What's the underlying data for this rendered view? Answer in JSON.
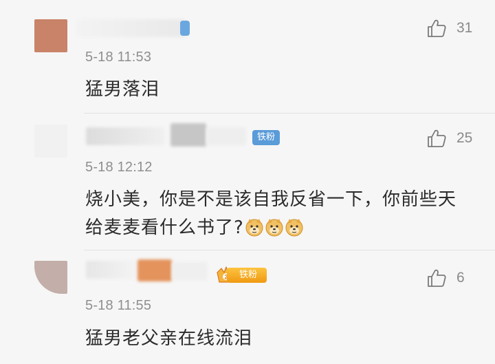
{
  "comments": [
    {
      "timestamp": "5-18 11:53",
      "text": "猛男落泪",
      "likes": "31",
      "avatar_color": "#c98368"
    },
    {
      "timestamp": "5-18 12:12",
      "text_line1": "烧小美，你是不是该自我反省一下，你前些天",
      "text_line2": "给麦麦看什么书了?",
      "badge": "铁粉",
      "likes": "25",
      "emojis": [
        "doge-emoji",
        "doge-emoji",
        "doge-emoji"
      ]
    },
    {
      "timestamp": "5-18 11:55",
      "text": "猛男老父亲在线流泪",
      "badge": "铁粉",
      "likes": "6",
      "avatar_color": "#c3aea9"
    }
  ],
  "icons": {
    "like": "thumbs-up-icon",
    "crown": "crown-icon"
  },
  "colors": {
    "badge_fans": "#5a9bd8",
    "badge_vip": "#f5a315",
    "text": "#2b2b2b",
    "meta": "#8e8e8e"
  }
}
